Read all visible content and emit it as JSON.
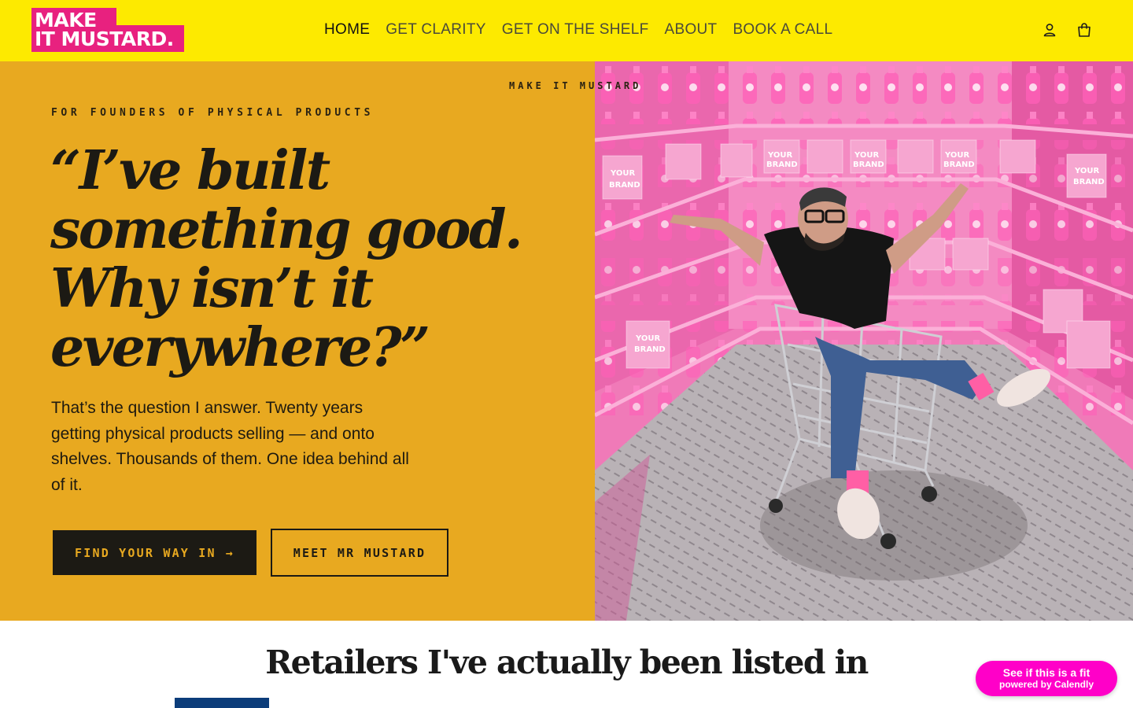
{
  "header": {
    "logo_line1": "MAKE",
    "logo_line2": "IT MUSTARD.",
    "nav": [
      {
        "label": "HOME",
        "active": true
      },
      {
        "label": "GET CLARITY"
      },
      {
        "label": "GET ON THE SHELF"
      },
      {
        "label": "ABOUT"
      },
      {
        "label": "BOOK A CALL"
      }
    ],
    "icons": {
      "account": "account-icon",
      "cart": "cart-icon"
    }
  },
  "hero": {
    "eyebrow": "FOR FOUNDERS OF PHYSICAL PRODUCTS",
    "brand_tag": "MAKE IT MUSTARD",
    "headline_lines": [
      "“I’ve built",
      "something good.",
      "Why isn’t it",
      "everywhere?”"
    ],
    "lead": "That’s the question I answer. Twenty years getting physical products selling — and onto shelves. Thousands of them. One idea behind all of it.",
    "cta_primary": "FIND YOUR WAY IN",
    "cta_primary_arrow": "→",
    "cta_secondary": "MEET MR MUSTARD",
    "box_label_1": "YOUR",
    "box_label_2": "BRAND"
  },
  "retailers": {
    "title": "Retailers I've actually been listed in"
  },
  "calendly": {
    "line1": "See if this is a fit",
    "line2": "powered by Calendly"
  },
  "colors": {
    "header_bg": "#fdea00",
    "hero_bg": "#e8a920",
    "logo_bg": "#e8217f",
    "dark": "#1c1a14",
    "calendly": "#ff00c8",
    "photo_pink": "#e86ab0"
  }
}
